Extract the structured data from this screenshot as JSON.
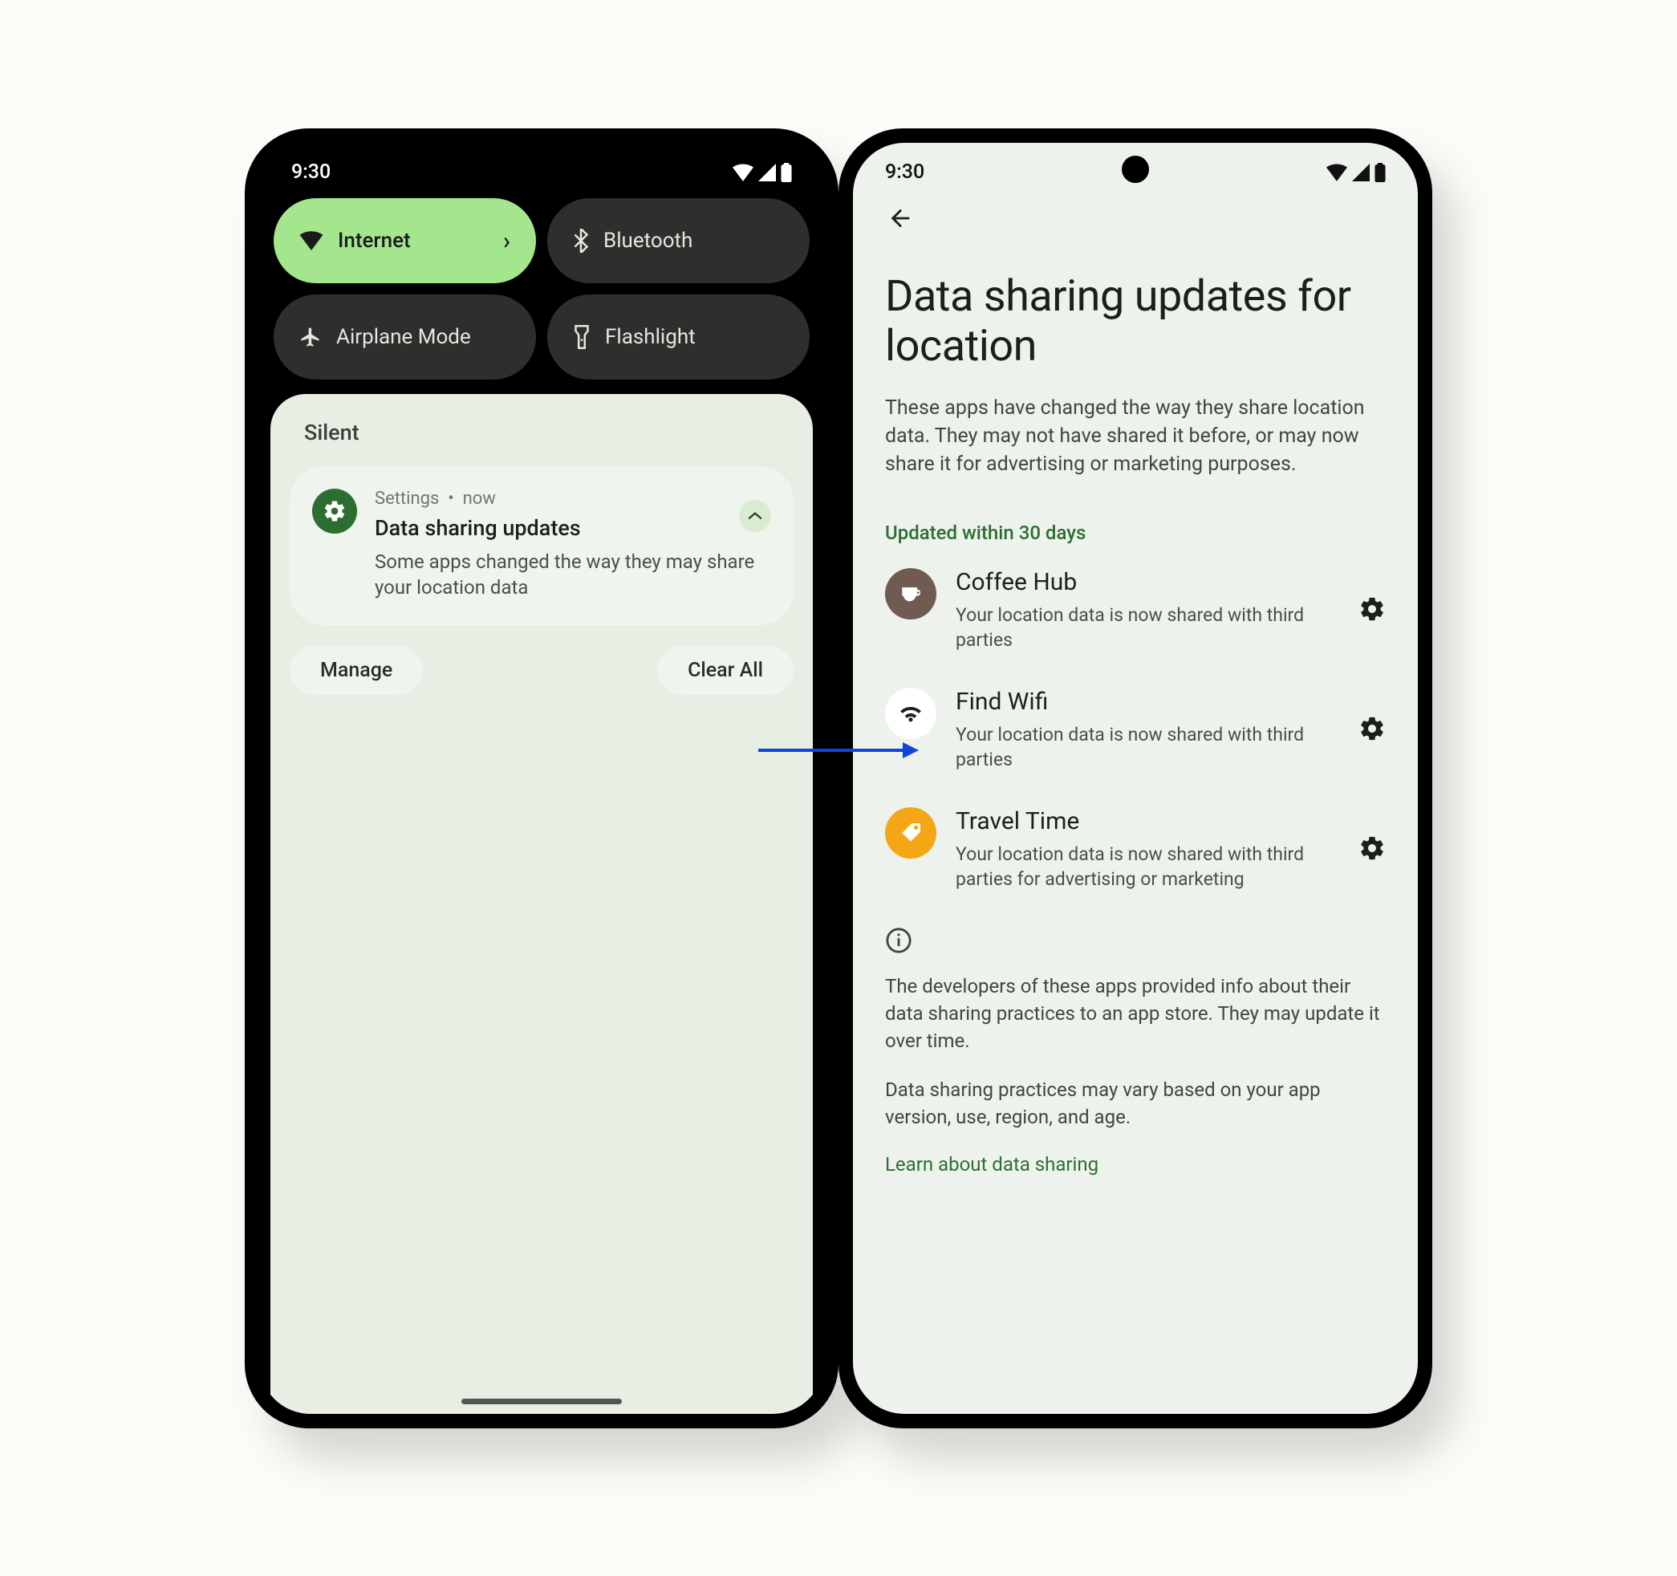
{
  "status": {
    "time": "9:30"
  },
  "quick_settings": {
    "tiles": [
      {
        "label": "Internet",
        "active": true,
        "icon": "wifi",
        "chevron": true
      },
      {
        "label": "Bluetooth",
        "active": false,
        "icon": "bluetooth",
        "chevron": false
      },
      {
        "label": "Airplane Mode",
        "active": false,
        "icon": "airplane",
        "chevron": false
      },
      {
        "label": "Flashlight",
        "active": false,
        "icon": "flashlight",
        "chevron": false
      }
    ]
  },
  "shade": {
    "section_label": "Silent",
    "notification": {
      "source": "Settings",
      "separator": "•",
      "time": "now",
      "title": "Data sharing updates",
      "body": "Some apps changed the way they may share your location data"
    },
    "actions": {
      "manage": "Manage",
      "clear_all": "Clear All"
    }
  },
  "settings_page": {
    "title": "Data sharing updates for location",
    "description": "These apps have changed the way they share location data. They may not have shared it before, or may now share it for advertising or marketing purposes.",
    "subheading": "Updated within 30 days",
    "apps": [
      {
        "name": "Coffee Hub",
        "subtitle": "Your location data is now shared with third parties",
        "icon_bg": "#6f5b52",
        "icon_fg": "#ffffff",
        "icon": "coffee"
      },
      {
        "name": "Find Wifi",
        "subtitle": "Your location data is now shared with third parties",
        "icon_bg": "#ffffff",
        "icon_fg": "#1d1f1c",
        "icon": "wifi"
      },
      {
        "name": "Travel Time",
        "subtitle": "Your location data is now shared with third parties for advertising or marketing",
        "icon_bg": "#f5a616",
        "icon_fg": "#ffffff",
        "icon": "tag"
      }
    ],
    "info_paragraphs": [
      "The developers of these apps provided info about their data sharing practices to an app store. They may update it over time.",
      "Data sharing practices may vary based on your app version, use, region, and age."
    ],
    "learn_more": "Learn about data sharing"
  }
}
